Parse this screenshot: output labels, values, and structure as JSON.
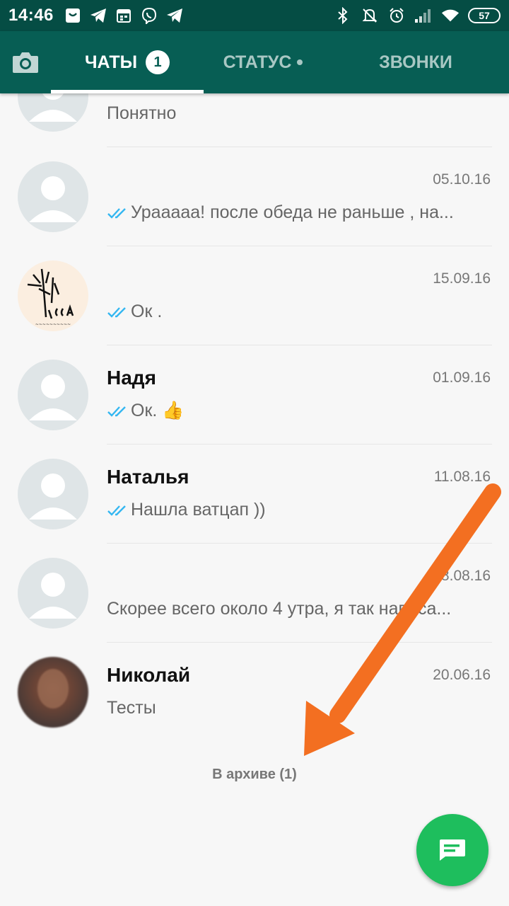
{
  "status_bar": {
    "time": "14:46",
    "battery": "57",
    "icons_left": [
      "app-square-icon",
      "telegram-icon",
      "calendar-icon",
      "viber-icon",
      "telegram-icon"
    ],
    "icons_right": [
      "bluetooth-icon",
      "mute-bell-icon",
      "alarm-icon",
      "signal-icon",
      "wifi-icon",
      "battery-icon"
    ]
  },
  "tabs": {
    "chats": "ЧАТЫ",
    "chats_badge": "1",
    "status": "СТАТУС",
    "calls": "ЗВОНКИ"
  },
  "colors": {
    "status_bar": "#054d44",
    "toolbar": "#075e54",
    "fab": "#1ebe5d",
    "tick": "#34b7f1",
    "arrow": "#f36f21"
  },
  "chats": [
    {
      "name": "",
      "date": "",
      "message": "Понятно",
      "ticks": false
    },
    {
      "name": "",
      "date": "05.10.16",
      "message": "Урааааа! после обеда не раньше , на...",
      "ticks": true
    },
    {
      "name": "",
      "date": "15.09.16",
      "message": "Ок .",
      "ticks": true
    },
    {
      "name": "Надя",
      "date": "01.09.16",
      "message": "Ок. 👍",
      "ticks": true
    },
    {
      "name": "Наталья",
      "date": "11.08.16",
      "message": "Нашла ватцап ))",
      "ticks": true
    },
    {
      "name": "",
      "date": "18.08.16",
      "message": "Скорее всего около 4 утра, я так написа...",
      "ticks": false
    },
    {
      "name": "Николай",
      "date": "20.06.16",
      "message": "Тесты",
      "ticks": false
    }
  ],
  "archive_label": "В архиве (1)"
}
